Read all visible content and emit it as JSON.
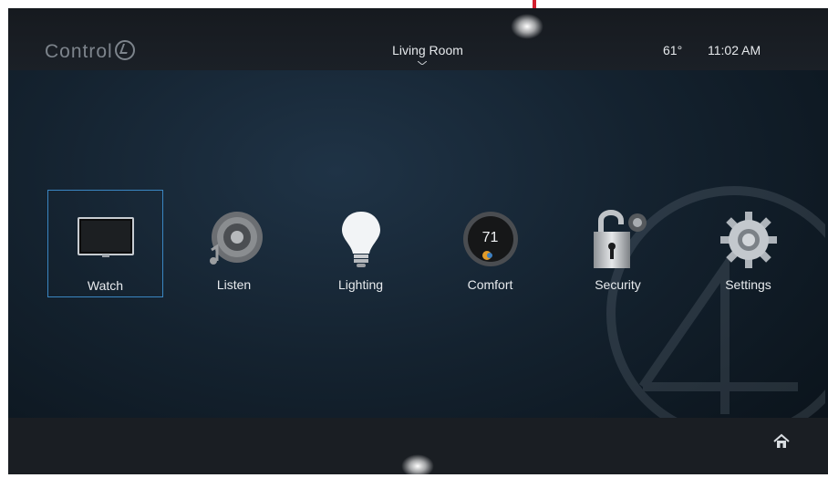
{
  "brand": {
    "logo_text": "Control",
    "logo_icon": "control4-logo-mark"
  },
  "header": {
    "room": "Living Room",
    "temperature": "61°",
    "time": "11:02 AM",
    "room_menu_icon": "chevron-down-icon"
  },
  "tiles": [
    {
      "label": "Watch",
      "icon": "tv-icon",
      "selected": true
    },
    {
      "label": "Listen",
      "icon": "speaker-icon",
      "selected": false
    },
    {
      "label": "Lighting",
      "icon": "lightbulb-icon",
      "selected": false
    },
    {
      "label": "Comfort",
      "icon": "thermostat-icon",
      "value": "71",
      "selected": false
    },
    {
      "label": "Security",
      "icon": "padlock-icon",
      "selected": false
    },
    {
      "label": "Settings",
      "icon": "gear-icon",
      "selected": false
    }
  ],
  "footer": {
    "home_icon": "home-icon"
  },
  "colors": {
    "accent": "#3a86c2",
    "marker": "#d21f2e"
  }
}
